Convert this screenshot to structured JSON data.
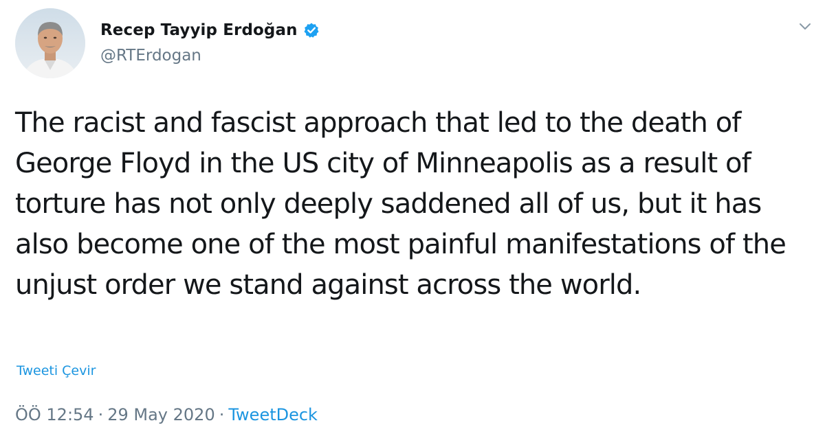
{
  "author": {
    "display_name": "Recep Tayyip Erdoğan",
    "handle": "@RTErdogan",
    "avatar_icon": "profile-photo",
    "verified_icon": "verified-badge-icon"
  },
  "tweet": {
    "text": "The racist and fascist approach that led to the death of George Floyd in the US city of Minneapolis as a result of torture has not only deeply saddened all of us, but it has also become one of the most painful manifestations of the unjust order we stand against across the world.",
    "translate_label": "Tweeti Çevir"
  },
  "meta": {
    "time": "ÖÖ 12:54",
    "separator": "·",
    "date": "29 May 2020",
    "source": "TweetDeck"
  },
  "menu": {
    "caret_icon": "chevron-down-icon"
  },
  "colors": {
    "link": "#1b95e0",
    "secondary_text": "#657786",
    "primary_text": "#14171a",
    "verified": "#1da1f2"
  }
}
